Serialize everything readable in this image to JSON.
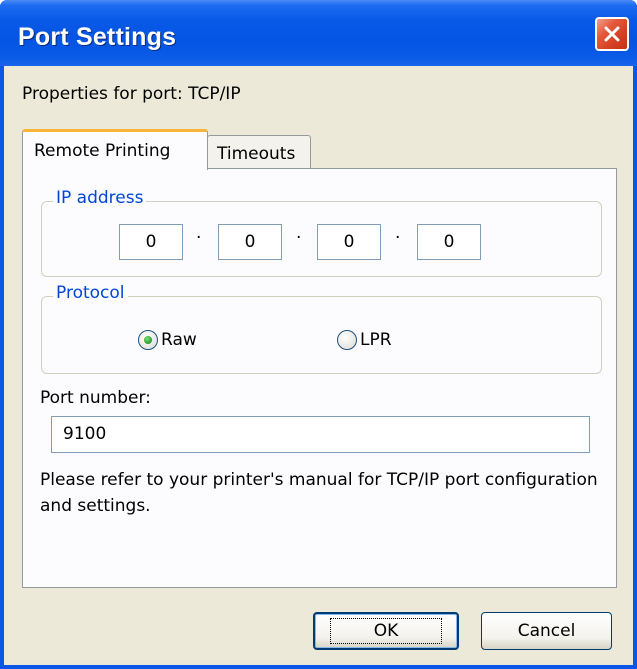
{
  "window": {
    "title": "Port Settings",
    "close_icon": "close-icon"
  },
  "subtitle": "Properties for port: TCP/IP",
  "tabs": [
    {
      "label": "Remote Printing",
      "active": true
    },
    {
      "label": "Timeouts",
      "active": false
    }
  ],
  "ip_group": {
    "legend": "IP address",
    "octets": [
      "0",
      "0",
      "0",
      "0"
    ],
    "separator": "·"
  },
  "protocol_group": {
    "legend": "Protocol",
    "options": [
      {
        "label": "Raw",
        "selected": true
      },
      {
        "label": "LPR",
        "selected": false
      }
    ]
  },
  "port": {
    "label": "Port number:",
    "value": "9100"
  },
  "note": "Please refer to your printer's manual for TCP/IP port configuration and settings.",
  "buttons": {
    "ok": "OK",
    "cancel": "Cancel"
  },
  "colors": {
    "titlebar": "#0554e3",
    "group_legend": "#0046d5",
    "active_tab_accent": "#f7b439",
    "dialog_background": "#ece9d8"
  }
}
